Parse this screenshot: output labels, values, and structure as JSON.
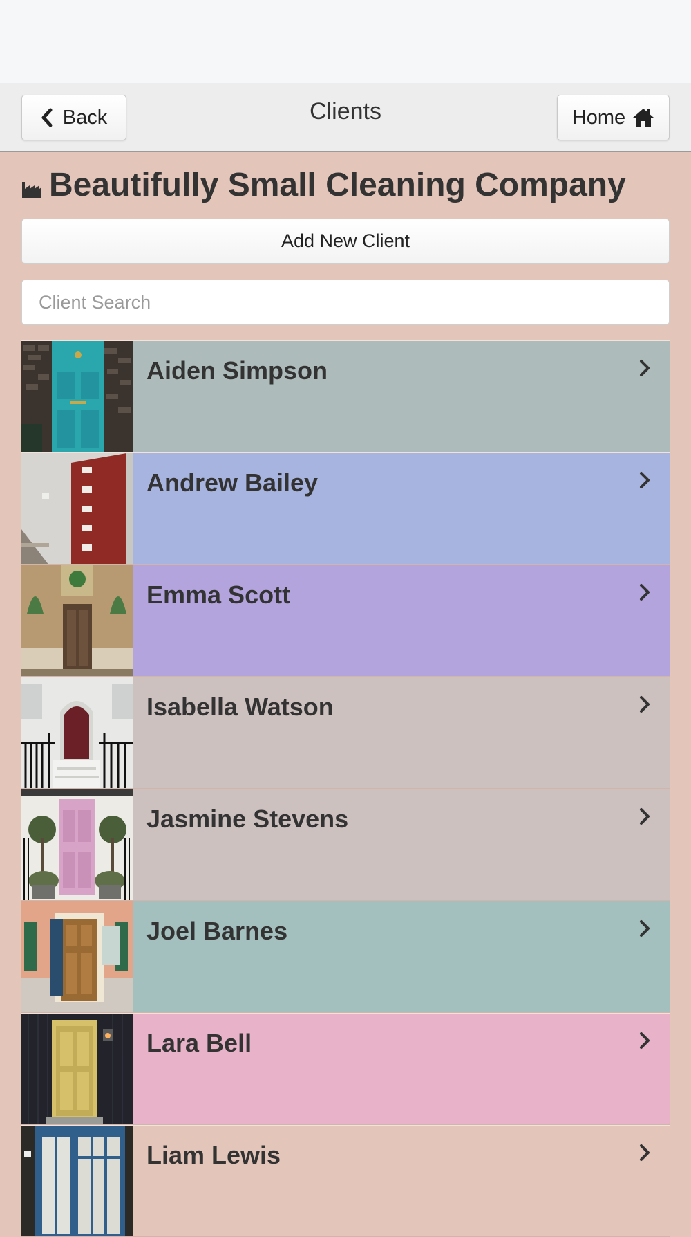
{
  "header": {
    "back_label": "Back",
    "title": "Clients",
    "home_label": "Home"
  },
  "company": {
    "icon": "factory-icon",
    "name": "Beautifully Small Cleaning Company"
  },
  "actions": {
    "add_client_label": "Add New Client"
  },
  "search": {
    "placeholder": "Client Search",
    "value": ""
  },
  "clients": [
    {
      "name": "Aiden Simpson",
      "color": "#adbbba",
      "door": "teal"
    },
    {
      "name": "Andrew Bailey",
      "color": "#a8b4e0",
      "door": "red-modern"
    },
    {
      "name": "Emma Scott",
      "color": "#b3a4de",
      "door": "ornate"
    },
    {
      "name": "Isabella Watson",
      "color": "#cdc1c0",
      "door": "maroon-arch"
    },
    {
      "name": "Jasmine Stevens",
      "color": "#cdc1c0",
      "door": "pink"
    },
    {
      "name": "Joel Barnes",
      "color": "#a3bfbe",
      "door": "wood-green-shutters"
    },
    {
      "name": "Lara Bell",
      "color": "#e8b3c9",
      "door": "yellow-dark-wall"
    },
    {
      "name": "Liam Lewis",
      "color": "#e3c5b9",
      "door": "blue-frame"
    }
  ]
}
